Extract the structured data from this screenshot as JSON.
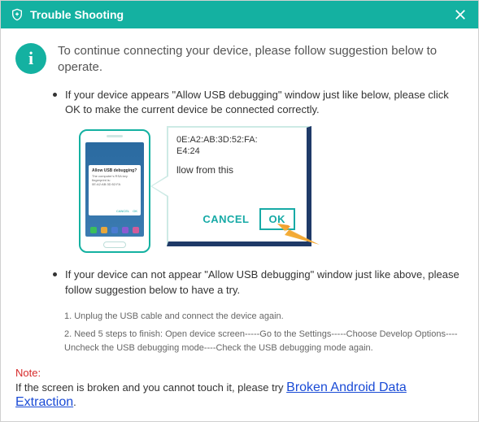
{
  "titlebar": {
    "title": "Trouble Shooting"
  },
  "info_badge_glyph": "i",
  "header": "To continue connecting your device, please follow suggestion below to operate.",
  "bullet1": "If your device appears \"Allow USB debugging\" window just like below, please click OK to make the current device  be connected correctly.",
  "popup": {
    "fingerprint_line1": "0E:A2:AB:3D:52:FA:",
    "fingerprint_line2": "E4:24",
    "allow_text": "llow from this",
    "cancel": "CANCEL",
    "ok": "OK"
  },
  "phone_dialog": {
    "title": "Allow USB debugging?"
  },
  "bullet2": "If your device can not appear \"Allow USB debugging\" window just like above, please follow suggestion below to have a try.",
  "steps": {
    "s1": "1. Unplug the USB cable and connect the device again.",
    "s2": "2. Need 5 steps to finish: Open device screen-----Go to the Settings-----Choose Develop Options----Uncheck the USB debugging mode----Check the USB debugging mode again."
  },
  "note": {
    "label": "Note:",
    "text_before": "If the screen is broken and you cannot touch it, please try ",
    "link": "Broken Android Data Extraction",
    "text_after": "."
  }
}
